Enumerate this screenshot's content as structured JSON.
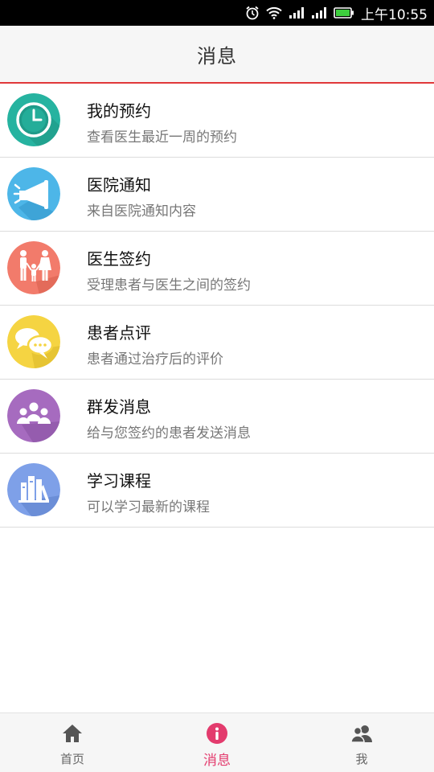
{
  "status_bar": {
    "time": "上午10:55",
    "icons": [
      "alarm-icon",
      "wifi-icon",
      "signal-icon",
      "signal-icon",
      "battery-icon"
    ]
  },
  "header": {
    "title": "消息"
  },
  "list": {
    "items": [
      {
        "title": "我的预约",
        "subtitle": "查看医生最近一周的预约",
        "icon": "clock-icon",
        "color": "#26b3a0"
      },
      {
        "title": "医院通知",
        "subtitle": "来自医院通知内容",
        "icon": "megaphone-icon",
        "color": "#4db6e8"
      },
      {
        "title": "医生签约",
        "subtitle": "受理患者与医生之间的签约",
        "icon": "family-icon",
        "color": "#f27b6b"
      },
      {
        "title": "患者点评",
        "subtitle": "患者通过治疗后的评价",
        "icon": "chat-bubbles-icon",
        "color": "#f5d442"
      },
      {
        "title": "群发消息",
        "subtitle": "给与您签约的患者发送消息",
        "icon": "group-icon",
        "color": "#a66bbf"
      },
      {
        "title": "学习课程",
        "subtitle": "可以学习最新的课程",
        "icon": "books-icon",
        "color": "#7ea0e8"
      }
    ]
  },
  "tab_bar": {
    "tabs": [
      {
        "label": "首页",
        "icon": "home-icon",
        "active": false
      },
      {
        "label": "消息",
        "icon": "info-icon",
        "active": true
      },
      {
        "label": "我",
        "icon": "users-icon",
        "active": false
      }
    ],
    "active_color": "#e33b6d"
  }
}
